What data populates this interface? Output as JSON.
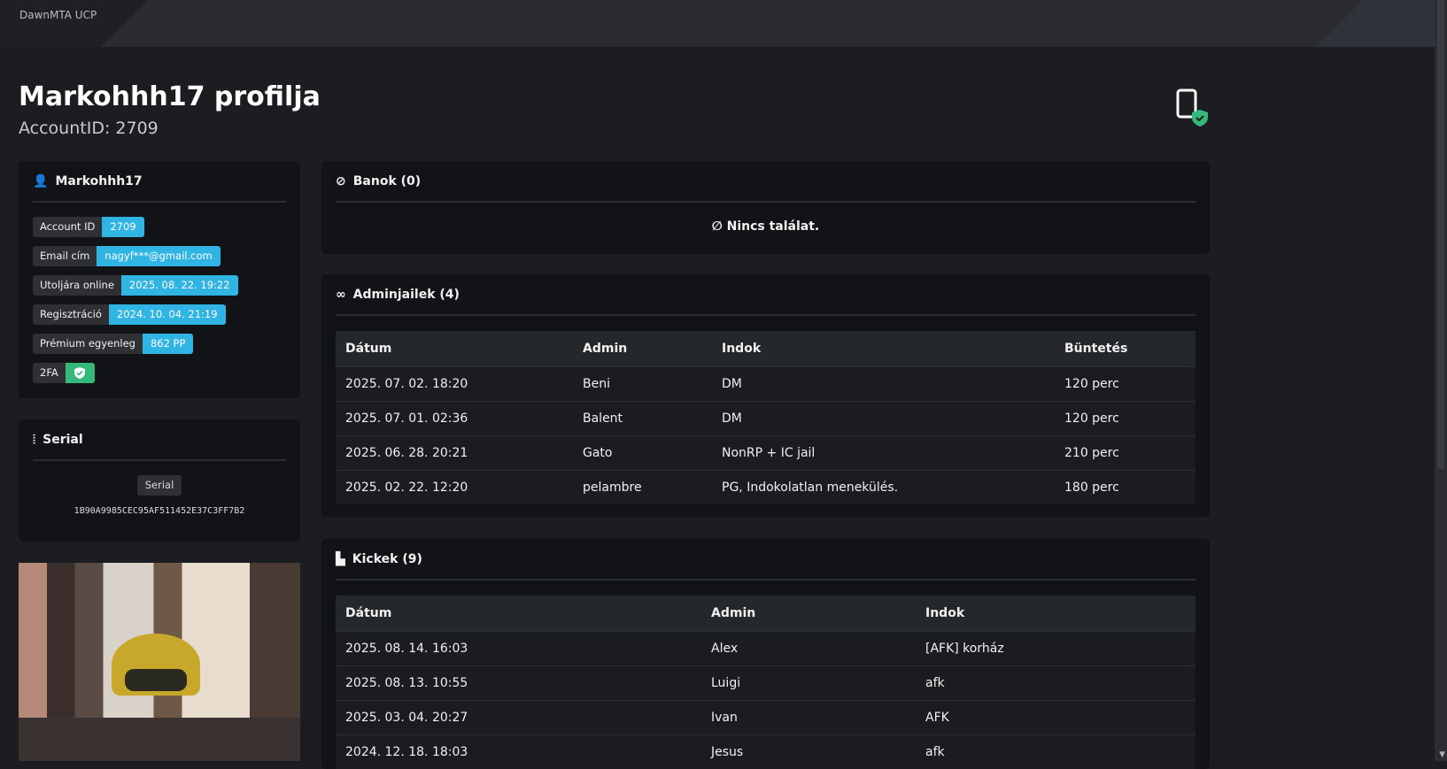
{
  "header": {
    "brand": "DawnMTA UCP"
  },
  "page": {
    "title": "Markohhh17 profilja",
    "subtitle": "AccountID: 2709"
  },
  "user_card": {
    "name": "Markohhh17",
    "rows": [
      {
        "label": "Account ID",
        "value": "2709"
      },
      {
        "label": "Email cím",
        "value": "nagyf***@gmail.com"
      },
      {
        "label": "Utoljára online",
        "value": "2025. 08. 22. 19:22"
      },
      {
        "label": "Regisztráció",
        "value": "2024. 10. 04. 21:19"
      },
      {
        "label": "Prémium egyenleg",
        "value": "862 PP"
      },
      {
        "label": "2FA",
        "value_icon": "shield-check-icon"
      }
    ]
  },
  "serial_card": {
    "title": "Serial",
    "button": "Serial",
    "value": "1B90A9985CEC95AF511452E37C3FF7B2"
  },
  "bans": {
    "title": "Banok (0)",
    "empty": "Nincs találat."
  },
  "adminjails": {
    "title": "Adminjailek (4)",
    "columns": [
      "Dátum",
      "Admin",
      "Indok",
      "Büntetés"
    ],
    "rows": [
      [
        "2025. 07. 02. 18:20",
        "Beni",
        "DM",
        "120 perc"
      ],
      [
        "2025. 07. 01. 02:36",
        "Balent",
        "DM",
        "120 perc"
      ],
      [
        "2025. 06. 28. 20:21",
        "Gato",
        "NonRP + IC jail",
        "210 perc"
      ],
      [
        "2025. 02. 22. 12:20",
        "pelambre",
        "PG, Indokolatlan menekülés.",
        "180 perc"
      ]
    ]
  },
  "kicks": {
    "title": "Kickek (9)",
    "columns": [
      "Dátum",
      "Admin",
      "Indok"
    ],
    "rows": [
      [
        "2025. 08. 14. 16:03",
        "Alex",
        "[AFK] korház"
      ],
      [
        "2025. 08. 13. 10:55",
        "Luigi",
        "afk"
      ],
      [
        "2025. 03. 04. 20:27",
        "Ivan",
        "AFK"
      ],
      [
        "2024. 12. 18. 18:03",
        "Jesus",
        "afk"
      ]
    ]
  },
  "colors": {
    "accent": "#2fb4e3",
    "success": "#35b97a"
  }
}
